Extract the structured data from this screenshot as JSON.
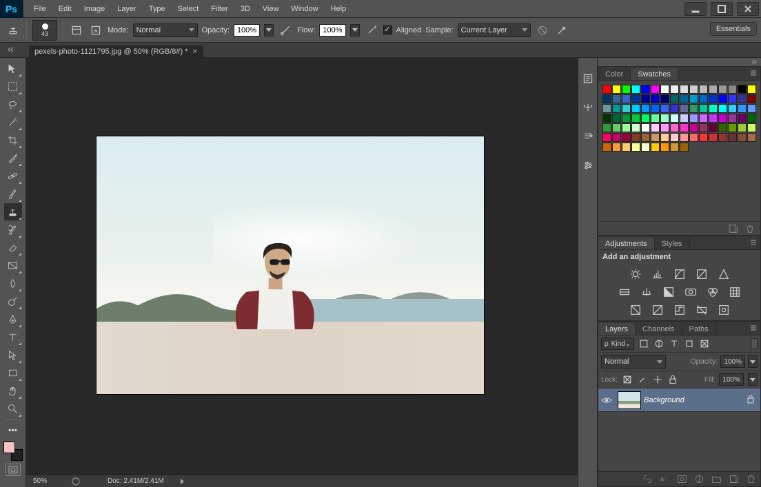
{
  "app": {
    "name": "Ps"
  },
  "menu": {
    "items": [
      "File",
      "Edit",
      "Image",
      "Layer",
      "Type",
      "Select",
      "Filter",
      "3D",
      "View",
      "Window",
      "Help"
    ]
  },
  "workspace": {
    "label": "Essentials"
  },
  "options": {
    "brush_size": "43",
    "mode_label": "Mode:",
    "mode_value": "Normal",
    "opacity_label": "Opacity:",
    "opacity_value": "100%",
    "flow_label": "Flow:",
    "flow_value": "100%",
    "aligned_label": "Aligned",
    "sample_label": "Sample:",
    "sample_value": "Current Layer"
  },
  "document": {
    "title": "pexels-photo-1121795.jpg @ 50% (RGB/8#) *"
  },
  "tools": [
    "move",
    "marquee",
    "lasso",
    "quick-select",
    "crop",
    "eyedropper",
    "spot-heal",
    "brush",
    "clone-stamp",
    "history-brush",
    "eraser",
    "gradient",
    "blur",
    "dodge",
    "pen",
    "type",
    "path-select",
    "rectangle",
    "hand",
    "zoom"
  ],
  "status": {
    "zoom": "50%",
    "doc_size": "Doc: 2.41M/2.41M"
  },
  "panels": {
    "swatches": {
      "tabs": [
        "Color",
        "Swatches"
      ],
      "active": 1,
      "colors": [
        "#ff0000",
        "#ffff00",
        "#00ff00",
        "#00ffff",
        "#0000ff",
        "#ff00ff",
        "#ffffff",
        "#eeeeee",
        "#dddddd",
        "#cccccc",
        "#bbbbbb",
        "#aaaaaa",
        "#999999",
        "#888888",
        "#000000",
        "#ffff00",
        "#003366",
        "#336699",
        "#3366cc",
        "#003399",
        "#000099",
        "#0000cc",
        "#000066",
        "#006666",
        "#006699",
        "#0099cc",
        "#0066cc",
        "#0033cc",
        "#0000ff",
        "#3333ff",
        "#333399",
        "#800000",
        "#669999",
        "#009999",
        "#33cccc",
        "#00ccff",
        "#0099ff",
        "#0066ff",
        "#3366ff",
        "#3333cc",
        "#666699",
        "#339966",
        "#00cc99",
        "#00ffcc",
        "#00ffff",
        "#33ccff",
        "#3399ff",
        "#6699ff",
        "#003300",
        "#006633",
        "#009933",
        "#00cc33",
        "#00ff66",
        "#66ff99",
        "#99ffcc",
        "#ccffff",
        "#ccccff",
        "#9999ff",
        "#cc66ff",
        "#cc33ff",
        "#cc00cc",
        "#993399",
        "#660066",
        "#006600",
        "#339933",
        "#66cc66",
        "#99ff99",
        "#ccffcc",
        "#ffffff",
        "#ffccff",
        "#ff99ff",
        "#ff66cc",
        "#ff33cc",
        "#cc0099",
        "#993366",
        "#660033",
        "#336600",
        "#669900",
        "#99cc33",
        "#ccff66",
        "#ff0066",
        "#cc0066",
        "#990033",
        "#804020",
        "#996633",
        "#cc9966",
        "#ffcc99",
        "#ffcccc",
        "#ff9999",
        "#ff6666",
        "#ff3333",
        "#cc3333",
        "#993333",
        "#663333",
        "#805030",
        "#a86848",
        "#cc6600",
        "#ff9933",
        "#ffcc66",
        "#ffff99",
        "#ffffcc",
        "#ffcc00",
        "#ff9900",
        "#cc9933",
        "#996600"
      ]
    },
    "adjustments": {
      "tabs": [
        "Adjustments",
        "Styles"
      ],
      "active": 0,
      "label": "Add an adjustment"
    },
    "layers": {
      "tabs": [
        "Layers",
        "Channels",
        "Paths"
      ],
      "active": 0,
      "filter_kind": "Kind",
      "blend_mode": "Normal",
      "opacity_label": "Opacity:",
      "opacity_value": "100%",
      "lock_label": "Lock:",
      "fill_label": "Fill:",
      "fill_value": "100%",
      "items": [
        {
          "name": "Background",
          "locked": true,
          "visible": true
        }
      ]
    }
  }
}
